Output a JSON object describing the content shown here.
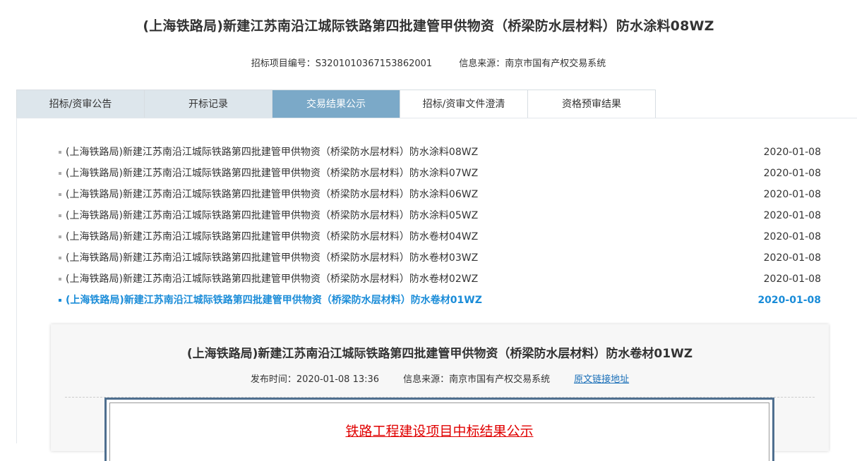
{
  "header": {
    "title": "(上海铁路局)新建江苏南沿江城际铁路第四批建管甲供物资（桥梁防水层材料）防水涂料08WZ",
    "project_no_label": "招标项目编号：",
    "project_no": "S3201010367153862001",
    "source_label": "信息来源：",
    "source": "南京市国有产权交易系统"
  },
  "tabs": [
    {
      "label": "招标/资审公告"
    },
    {
      "label": "开标记录"
    },
    {
      "label": "交易结果公示"
    },
    {
      "label": "招标/资审文件澄清"
    },
    {
      "label": "资格预审结果"
    }
  ],
  "list": [
    {
      "title": "(上海铁路局)新建江苏南沿江城际铁路第四批建管甲供物资（桥梁防水层材料）防水涂料08WZ",
      "date": "2020-01-08"
    },
    {
      "title": "(上海铁路局)新建江苏南沿江城际铁路第四批建管甲供物资（桥梁防水层材料）防水涂料07WZ",
      "date": "2020-01-08"
    },
    {
      "title": "(上海铁路局)新建江苏南沿江城际铁路第四批建管甲供物资（桥梁防水层材料）防水涂料06WZ",
      "date": "2020-01-08"
    },
    {
      "title": "(上海铁路局)新建江苏南沿江城际铁路第四批建管甲供物资（桥梁防水层材料）防水涂料05WZ",
      "date": "2020-01-08"
    },
    {
      "title": "(上海铁路局)新建江苏南沿江城际铁路第四批建管甲供物资（桥梁防水层材料）防水卷材04WZ",
      "date": "2020-01-08"
    },
    {
      "title": "(上海铁路局)新建江苏南沿江城际铁路第四批建管甲供物资（桥梁防水层材料）防水卷材03WZ",
      "date": "2020-01-08"
    },
    {
      "title": "(上海铁路局)新建江苏南沿江城际铁路第四批建管甲供物资（桥梁防水层材料）防水卷材02WZ",
      "date": "2020-01-08"
    },
    {
      "title": "(上海铁路局)新建江苏南沿江城际铁路第四批建管甲供物资（桥梁防水层材料）防水卷材01WZ",
      "date": "2020-01-08"
    }
  ],
  "detail": {
    "title": "(上海铁路局)新建江苏南沿江城际铁路第四批建管甲供物资（桥梁防水层材料）防水卷材01WZ",
    "publish_label": "发布时间：",
    "publish_time": "2020-01-08 13:36",
    "source_label": "信息来源：",
    "source": "南京市国有产权交易系统",
    "link_label": "原文链接地址",
    "doc_heading": "铁路工程建设项目中标结果公示"
  },
  "colors": {
    "tab_active": "#7ba9c8",
    "tab_inactive": "#dde6ec",
    "selected_link": "#1a8cd8",
    "doc_heading": "#e00000"
  }
}
